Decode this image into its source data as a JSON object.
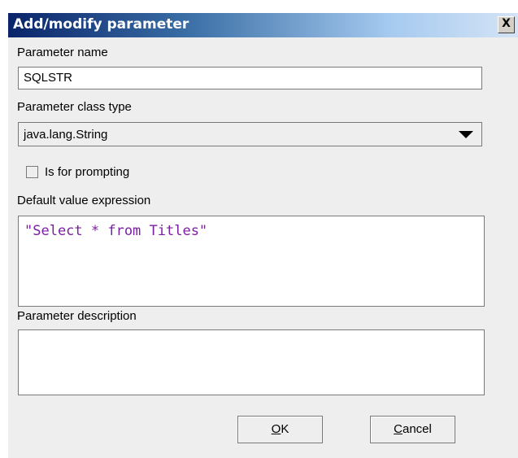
{
  "window": {
    "title": "Add/modify parameter",
    "close_label": "X"
  },
  "form": {
    "parameter_name": {
      "label": "Parameter name",
      "value": "SQLSTR"
    },
    "parameter_class_type": {
      "label": "Parameter class type",
      "selected": "java.lang.String"
    },
    "is_for_prompting": {
      "label": "Is for prompting",
      "checked": false
    },
    "default_value_expression": {
      "label": "Default value expression",
      "value": "\"Select * from Titles\""
    },
    "parameter_description": {
      "label": "Parameter description",
      "value": ""
    }
  },
  "buttons": {
    "ok": {
      "mnemonic": "O",
      "rest": "K"
    },
    "cancel": {
      "mnemonic": "C",
      "rest": "ancel"
    }
  },
  "colors": {
    "expression_text": "#7b1fa2",
    "titlebar_start": "#0a246a",
    "dialog_background": "#eeeeee"
  }
}
